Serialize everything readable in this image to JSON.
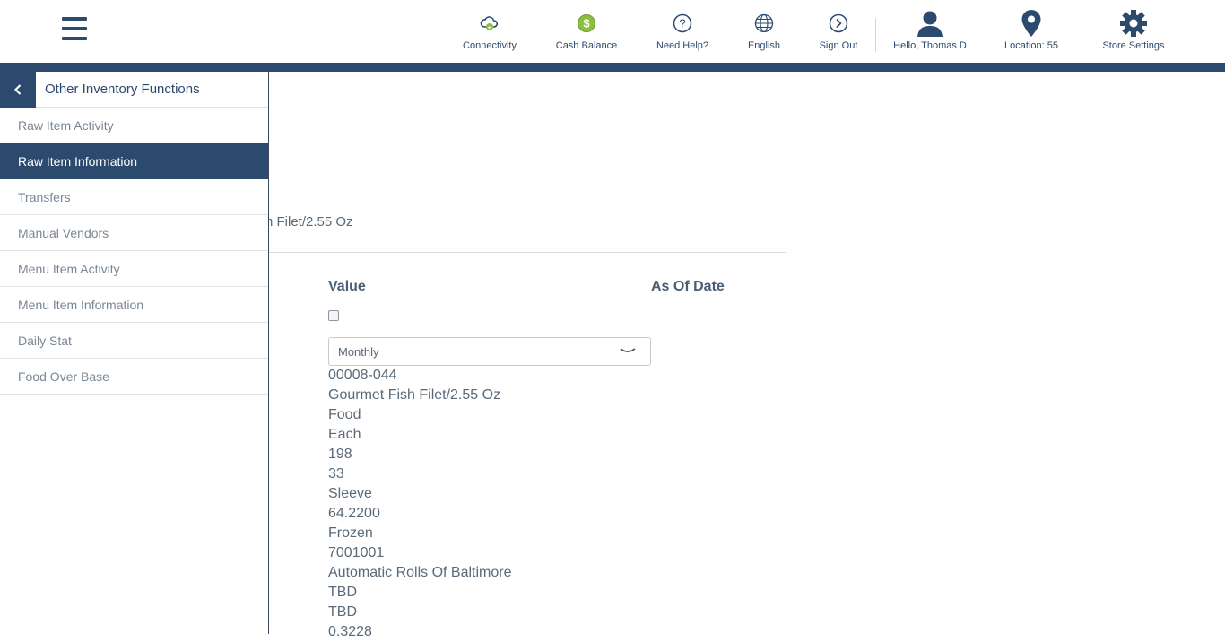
{
  "header": {
    "nav": [
      {
        "label": "Connectivity",
        "icon": "cloud-icon"
      },
      {
        "label": "Cash Balance",
        "icon": "dollar-icon"
      },
      {
        "label": "Need Help?",
        "icon": "help-icon"
      },
      {
        "label": "English",
        "icon": "globe-icon"
      },
      {
        "label": "Sign Out",
        "icon": "sign-out-icon"
      },
      {
        "label": "Hello, Thomas D",
        "icon": "user-icon"
      },
      {
        "label": "Location: 55",
        "icon": "location-pin-icon"
      },
      {
        "label": "Store Settings",
        "icon": "gear-icon"
      }
    ]
  },
  "sidebar": {
    "title": "Other Inventory Functions",
    "items": [
      {
        "label": "Raw Item Activity"
      },
      {
        "label": "Raw Item Information"
      },
      {
        "label": "Transfers"
      },
      {
        "label": "Manual Vendors"
      },
      {
        "label": "Menu Item Activity"
      },
      {
        "label": "Menu Item Information"
      },
      {
        "label": "Daily Stat"
      },
      {
        "label": "Food Over Base"
      }
    ],
    "active": "Raw Item Information"
  },
  "main": {
    "partial_title": "h Filet/2.55 Oz",
    "columns": {
      "value": "Value",
      "as_of_date": "As Of Date"
    },
    "frequency_select": "Monthly",
    "values": [
      "00008-044",
      "Gourmet Fish Filet/2.55 Oz",
      "Food",
      "Each",
      "198",
      "33",
      "Sleeve",
      "64.2200",
      "Frozen",
      "7001001",
      "Automatic Rolls Of Baltimore",
      "TBD",
      "TBD",
      "0.3228"
    ]
  },
  "colors": {
    "primary": "#2c4a6e",
    "accent_green": "#8dbf3f"
  }
}
